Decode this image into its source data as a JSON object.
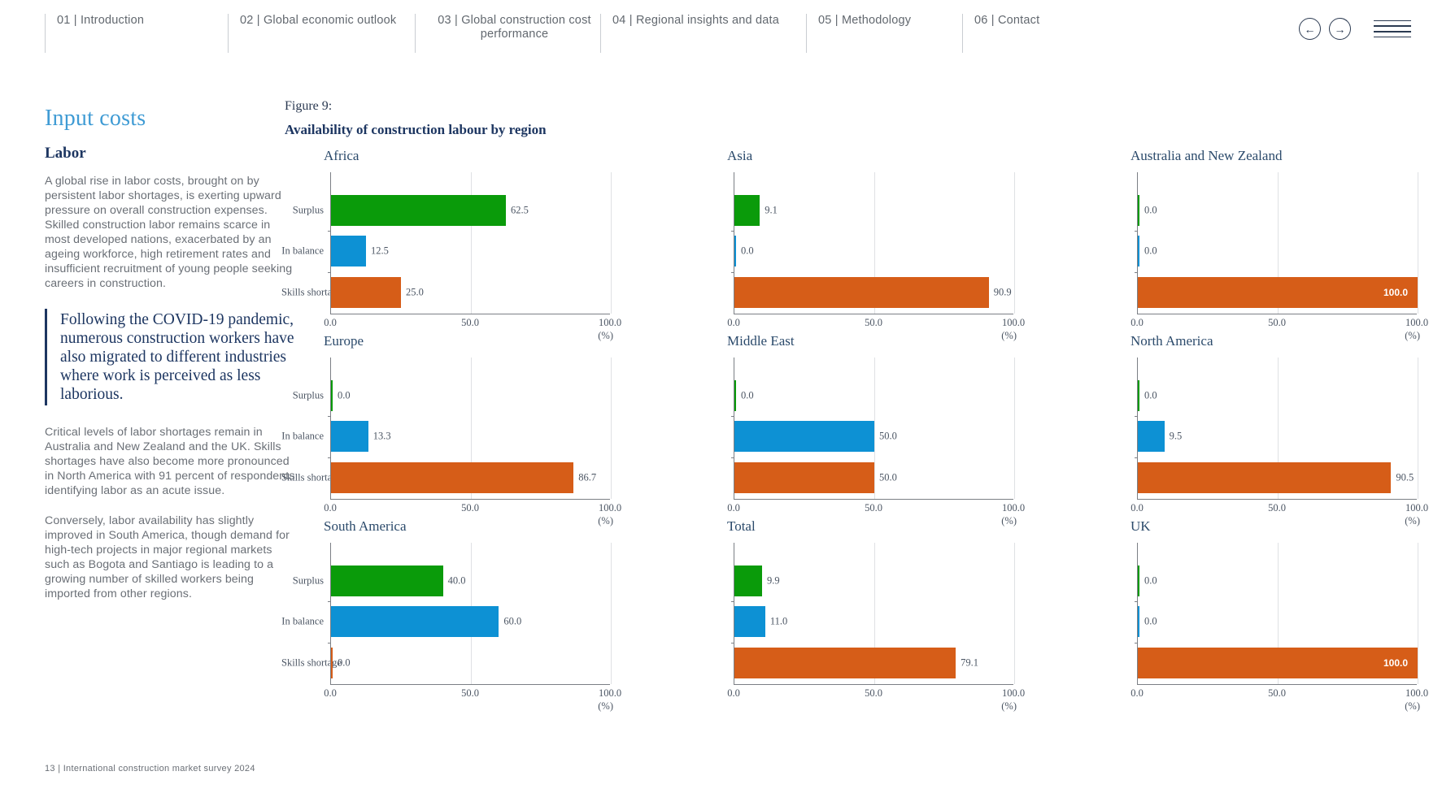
{
  "nav": {
    "items": [
      {
        "label": "01 | Introduction"
      },
      {
        "label": "02 | Global economic outlook"
      },
      {
        "label": "03 | Global construction cost performance"
      },
      {
        "label": "04 | Regional insights and data"
      },
      {
        "label": "05 | Methodology"
      },
      {
        "label": "06 | Contact"
      }
    ],
    "prev_icon": "arrow-left-icon",
    "next_icon": "arrow-right-icon",
    "menu_icon": "hamburger-menu-icon",
    "prev_glyph": "←",
    "next_glyph": "→"
  },
  "sidebar": {
    "section_heading": "Input costs",
    "sub_heading": "Labor",
    "paragraph_1": "A global rise in labor costs, brought on by persistent labor shortages, is exerting upward pressure on overall construction expenses. Skilled construction labor remains scarce in most developed nations, exacerbated by an ageing workforce, high retirement rates and insufficient recruitment of young people seeking careers in construction.",
    "pullquote": "Following the COVID-19 pandemic, numerous construction workers have also migrated to different industries where work is perceived as less laborious.",
    "paragraph_2": "Critical levels of labor shortages remain in Australia and New Zealand and the UK. Skills shortages have also become more pronounced in North America with 91 percent of respondents identifying labor as an acute issue.",
    "paragraph_3": "Conversely, labor availability has slightly improved in South America, though demand for high-tech projects in major regional markets such as Bogota and Santiago is leading to a growing number of skilled workers being imported from other regions."
  },
  "figure": {
    "number": "Figure 9:",
    "title": "Availability of construction labour by region"
  },
  "footer": {
    "text": "13  |  International construction market survey 2024"
  },
  "colors": {
    "surplus": "#0a9b0a",
    "in_balance": "#0d91d4",
    "skills_shortage": "#d65d18",
    "heading_blue": "#3f9bd4",
    "navy": "#1d3661",
    "panel_title": "#2b4a6b"
  },
  "chart_data": {
    "type": "bar",
    "title": "Availability of construction labour by region",
    "subtitle": "Figure 9:",
    "orientation": "horizontal",
    "categories": [
      "Surplus",
      "In balance",
      "Skills shortage"
    ],
    "series_colors": [
      "#0a9b0a",
      "#0d91d4",
      "#d65d18"
    ],
    "xlabel": "(%)",
    "ylabel": "",
    "xlim": [
      0,
      100
    ],
    "xticks": [
      "0.0",
      "50.0",
      "100.0"
    ],
    "xtick_values": [
      0,
      50,
      100
    ],
    "grid": true,
    "legend": "none",
    "panels": [
      {
        "name": "Africa",
        "values": [
          62.5,
          12.5,
          25.0
        ],
        "labels": [
          "62.5",
          "12.5",
          "25.0"
        ]
      },
      {
        "name": "Asia",
        "values": [
          9.1,
          0.0,
          90.9
        ],
        "labels": [
          "9.1",
          "0.0",
          "90.9"
        ]
      },
      {
        "name": "Australia and New Zealand",
        "values": [
          0.0,
          0.0,
          100.0
        ],
        "labels": [
          "0.0",
          "0.0",
          "100.0"
        ]
      },
      {
        "name": "Europe",
        "values": [
          0.0,
          13.3,
          86.7
        ],
        "labels": [
          "0.0",
          "13.3",
          "86.7"
        ]
      },
      {
        "name": "Middle East",
        "values": [
          0.0,
          50.0,
          50.0
        ],
        "labels": [
          "0.0",
          "50.0",
          "50.0"
        ]
      },
      {
        "name": "North America",
        "values": [
          0.0,
          9.5,
          90.5
        ],
        "labels": [
          "0.0",
          "9.5",
          "90.5"
        ]
      },
      {
        "name": "South America",
        "values": [
          40.0,
          60.0,
          0.0
        ],
        "labels": [
          "40.0",
          "60.0",
          "0.0"
        ]
      },
      {
        "name": "Total",
        "values": [
          9.9,
          11.0,
          79.1
        ],
        "labels": [
          "9.9",
          "11.0",
          "79.1"
        ]
      },
      {
        "name": "UK",
        "values": [
          0.0,
          0.0,
          100.0
        ],
        "labels": [
          "0.0",
          "0.0",
          "100.0"
        ]
      }
    ]
  }
}
